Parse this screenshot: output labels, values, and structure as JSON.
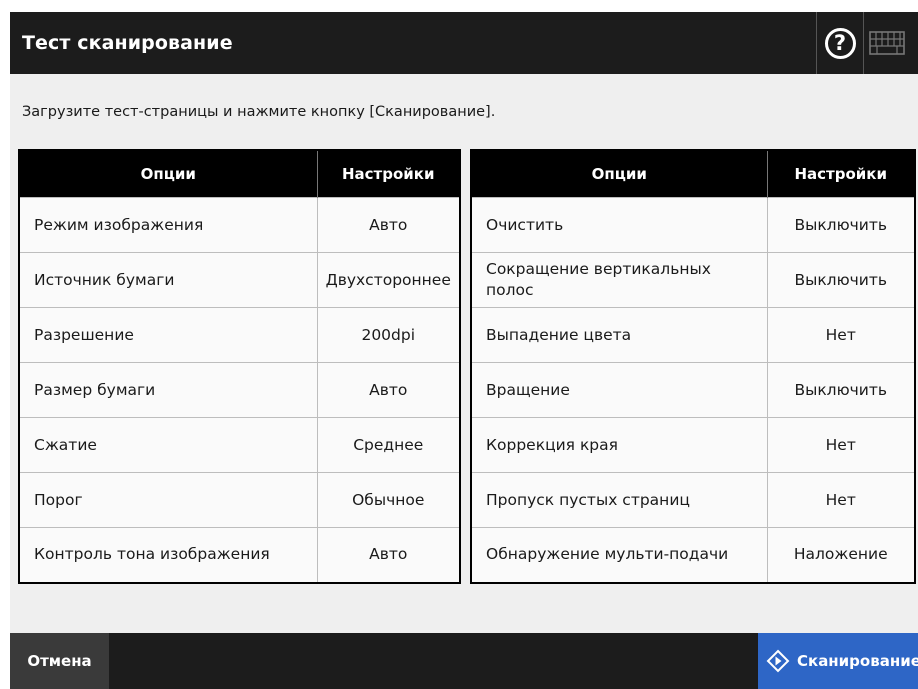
{
  "header": {
    "title": "Тест сканирование",
    "help_icon": "help-icon",
    "keyboard_icon": "keyboard-icon"
  },
  "instruction": "Загрузите тест-страницы и нажмите кнопку [Сканирование].",
  "table_left": {
    "headers": [
      "Опции",
      "Настройки"
    ],
    "rows": [
      [
        "Режим изображения",
        "Авто"
      ],
      [
        "Источник бумаги",
        "Двухстороннее"
      ],
      [
        "Разрешение",
        "200dpi"
      ],
      [
        "Размер бумаги",
        "Авто"
      ],
      [
        "Сжатие",
        "Среднее"
      ],
      [
        "Порог",
        "Обычное"
      ],
      [
        "Контроль тона изображения",
        "Авто"
      ]
    ]
  },
  "table_right": {
    "headers": [
      "Опции",
      "Настройки"
    ],
    "rows": [
      [
        "Очистить",
        "Выключить"
      ],
      [
        "Сокращение вертикальных полос",
        "Выключить"
      ],
      [
        "Выпадение цвета",
        "Нет"
      ],
      [
        "Вращение",
        "Выключить"
      ],
      [
        "Коррекция края",
        "Нет"
      ],
      [
        "Пропуск пустых страниц",
        "Нет"
      ],
      [
        "Обнаружение мульти-подачи",
        "Наложение"
      ]
    ]
  },
  "footer": {
    "cancel_label": "Отмена",
    "scan_label": "Сканирование",
    "scan_icon": "scan-diamond-icon"
  },
  "colors": {
    "header_bg": "#1c1c1c",
    "page_bg": "#efefef",
    "scan_button": "#2e66c6",
    "cancel_button": "#3a3a3a"
  }
}
